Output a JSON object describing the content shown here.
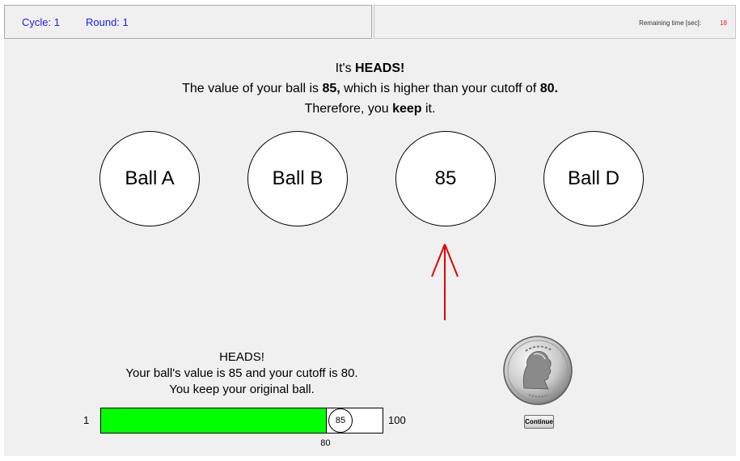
{
  "header": {
    "cycle_label": "Cycle: 1",
    "round_label": "Round: 1",
    "timer_label": "Remaining time [sec]:",
    "timer_value": "18"
  },
  "result_message": {
    "line1_prefix": "It's ",
    "line1_bold": "HEADS!",
    "line2_prefix": "The value of your ball is ",
    "line2_value": "85,",
    "line2_middle": " which is higher than your cutoff of ",
    "line2_cutoff": "80.",
    "line3_prefix": "Therefore, you ",
    "line3_bold": "keep",
    "line3_suffix": " it."
  },
  "balls": [
    {
      "label": "Ball A"
    },
    {
      "label": "Ball B"
    },
    {
      "label": "85"
    },
    {
      "label": "Ball D"
    }
  ],
  "summary": {
    "line1": "HEADS!",
    "line2": "Your ball's value is 85 and your cutoff is 80.",
    "line3": "You keep your original ball."
  },
  "value_bar": {
    "min_label": "1",
    "max_label": "100",
    "min": 1,
    "max": 100,
    "cutoff": 80,
    "cutoff_label": "80",
    "ball_value": 85,
    "ball_label": "85"
  },
  "continue_button": {
    "label": "Continue"
  },
  "colors": {
    "header_text": "#1a1aff",
    "timer_value": "#e02020",
    "arrow": "#e60000",
    "bar_fill": "#00ff00"
  },
  "icons": {
    "coin": "quarter-coin-icon",
    "arrow": "arrow-up-icon"
  }
}
